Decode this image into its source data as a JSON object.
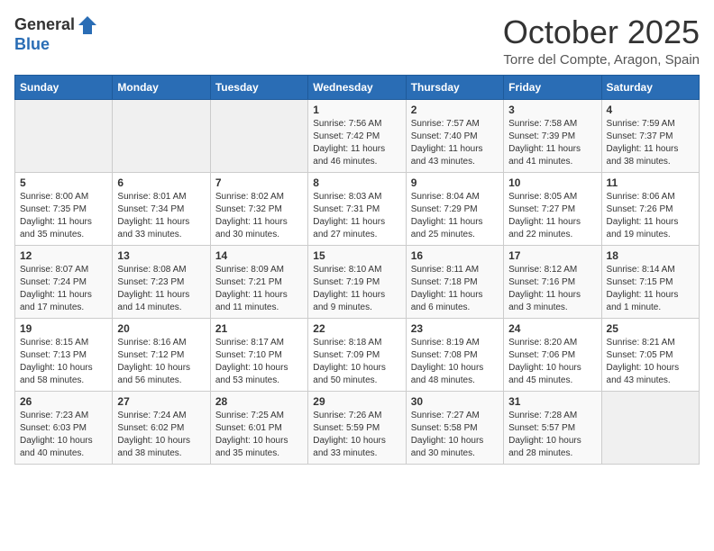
{
  "header": {
    "logo_general": "General",
    "logo_blue": "Blue",
    "month": "October 2025",
    "location": "Torre del Compte, Aragon, Spain"
  },
  "days_of_week": [
    "Sunday",
    "Monday",
    "Tuesday",
    "Wednesday",
    "Thursday",
    "Friday",
    "Saturday"
  ],
  "weeks": [
    [
      {
        "day": "",
        "info": ""
      },
      {
        "day": "",
        "info": ""
      },
      {
        "day": "",
        "info": ""
      },
      {
        "day": "1",
        "info": "Sunrise: 7:56 AM\nSunset: 7:42 PM\nDaylight: 11 hours\nand 46 minutes."
      },
      {
        "day": "2",
        "info": "Sunrise: 7:57 AM\nSunset: 7:40 PM\nDaylight: 11 hours\nand 43 minutes."
      },
      {
        "day": "3",
        "info": "Sunrise: 7:58 AM\nSunset: 7:39 PM\nDaylight: 11 hours\nand 41 minutes."
      },
      {
        "day": "4",
        "info": "Sunrise: 7:59 AM\nSunset: 7:37 PM\nDaylight: 11 hours\nand 38 minutes."
      }
    ],
    [
      {
        "day": "5",
        "info": "Sunrise: 8:00 AM\nSunset: 7:35 PM\nDaylight: 11 hours\nand 35 minutes."
      },
      {
        "day": "6",
        "info": "Sunrise: 8:01 AM\nSunset: 7:34 PM\nDaylight: 11 hours\nand 33 minutes."
      },
      {
        "day": "7",
        "info": "Sunrise: 8:02 AM\nSunset: 7:32 PM\nDaylight: 11 hours\nand 30 minutes."
      },
      {
        "day": "8",
        "info": "Sunrise: 8:03 AM\nSunset: 7:31 PM\nDaylight: 11 hours\nand 27 minutes."
      },
      {
        "day": "9",
        "info": "Sunrise: 8:04 AM\nSunset: 7:29 PM\nDaylight: 11 hours\nand 25 minutes."
      },
      {
        "day": "10",
        "info": "Sunrise: 8:05 AM\nSunset: 7:27 PM\nDaylight: 11 hours\nand 22 minutes."
      },
      {
        "day": "11",
        "info": "Sunrise: 8:06 AM\nSunset: 7:26 PM\nDaylight: 11 hours\nand 19 minutes."
      }
    ],
    [
      {
        "day": "12",
        "info": "Sunrise: 8:07 AM\nSunset: 7:24 PM\nDaylight: 11 hours\nand 17 minutes."
      },
      {
        "day": "13",
        "info": "Sunrise: 8:08 AM\nSunset: 7:23 PM\nDaylight: 11 hours\nand 14 minutes."
      },
      {
        "day": "14",
        "info": "Sunrise: 8:09 AM\nSunset: 7:21 PM\nDaylight: 11 hours\nand 11 minutes."
      },
      {
        "day": "15",
        "info": "Sunrise: 8:10 AM\nSunset: 7:19 PM\nDaylight: 11 hours\nand 9 minutes."
      },
      {
        "day": "16",
        "info": "Sunrise: 8:11 AM\nSunset: 7:18 PM\nDaylight: 11 hours\nand 6 minutes."
      },
      {
        "day": "17",
        "info": "Sunrise: 8:12 AM\nSunset: 7:16 PM\nDaylight: 11 hours\nand 3 minutes."
      },
      {
        "day": "18",
        "info": "Sunrise: 8:14 AM\nSunset: 7:15 PM\nDaylight: 11 hours\nand 1 minute."
      }
    ],
    [
      {
        "day": "19",
        "info": "Sunrise: 8:15 AM\nSunset: 7:13 PM\nDaylight: 10 hours\nand 58 minutes."
      },
      {
        "day": "20",
        "info": "Sunrise: 8:16 AM\nSunset: 7:12 PM\nDaylight: 10 hours\nand 56 minutes."
      },
      {
        "day": "21",
        "info": "Sunrise: 8:17 AM\nSunset: 7:10 PM\nDaylight: 10 hours\nand 53 minutes."
      },
      {
        "day": "22",
        "info": "Sunrise: 8:18 AM\nSunset: 7:09 PM\nDaylight: 10 hours\nand 50 minutes."
      },
      {
        "day": "23",
        "info": "Sunrise: 8:19 AM\nSunset: 7:08 PM\nDaylight: 10 hours\nand 48 minutes."
      },
      {
        "day": "24",
        "info": "Sunrise: 8:20 AM\nSunset: 7:06 PM\nDaylight: 10 hours\nand 45 minutes."
      },
      {
        "day": "25",
        "info": "Sunrise: 8:21 AM\nSunset: 7:05 PM\nDaylight: 10 hours\nand 43 minutes."
      }
    ],
    [
      {
        "day": "26",
        "info": "Sunrise: 7:23 AM\nSunset: 6:03 PM\nDaylight: 10 hours\nand 40 minutes."
      },
      {
        "day": "27",
        "info": "Sunrise: 7:24 AM\nSunset: 6:02 PM\nDaylight: 10 hours\nand 38 minutes."
      },
      {
        "day": "28",
        "info": "Sunrise: 7:25 AM\nSunset: 6:01 PM\nDaylight: 10 hours\nand 35 minutes."
      },
      {
        "day": "29",
        "info": "Sunrise: 7:26 AM\nSunset: 5:59 PM\nDaylight: 10 hours\nand 33 minutes."
      },
      {
        "day": "30",
        "info": "Sunrise: 7:27 AM\nSunset: 5:58 PM\nDaylight: 10 hours\nand 30 minutes."
      },
      {
        "day": "31",
        "info": "Sunrise: 7:28 AM\nSunset: 5:57 PM\nDaylight: 10 hours\nand 28 minutes."
      },
      {
        "day": "",
        "info": ""
      }
    ]
  ]
}
